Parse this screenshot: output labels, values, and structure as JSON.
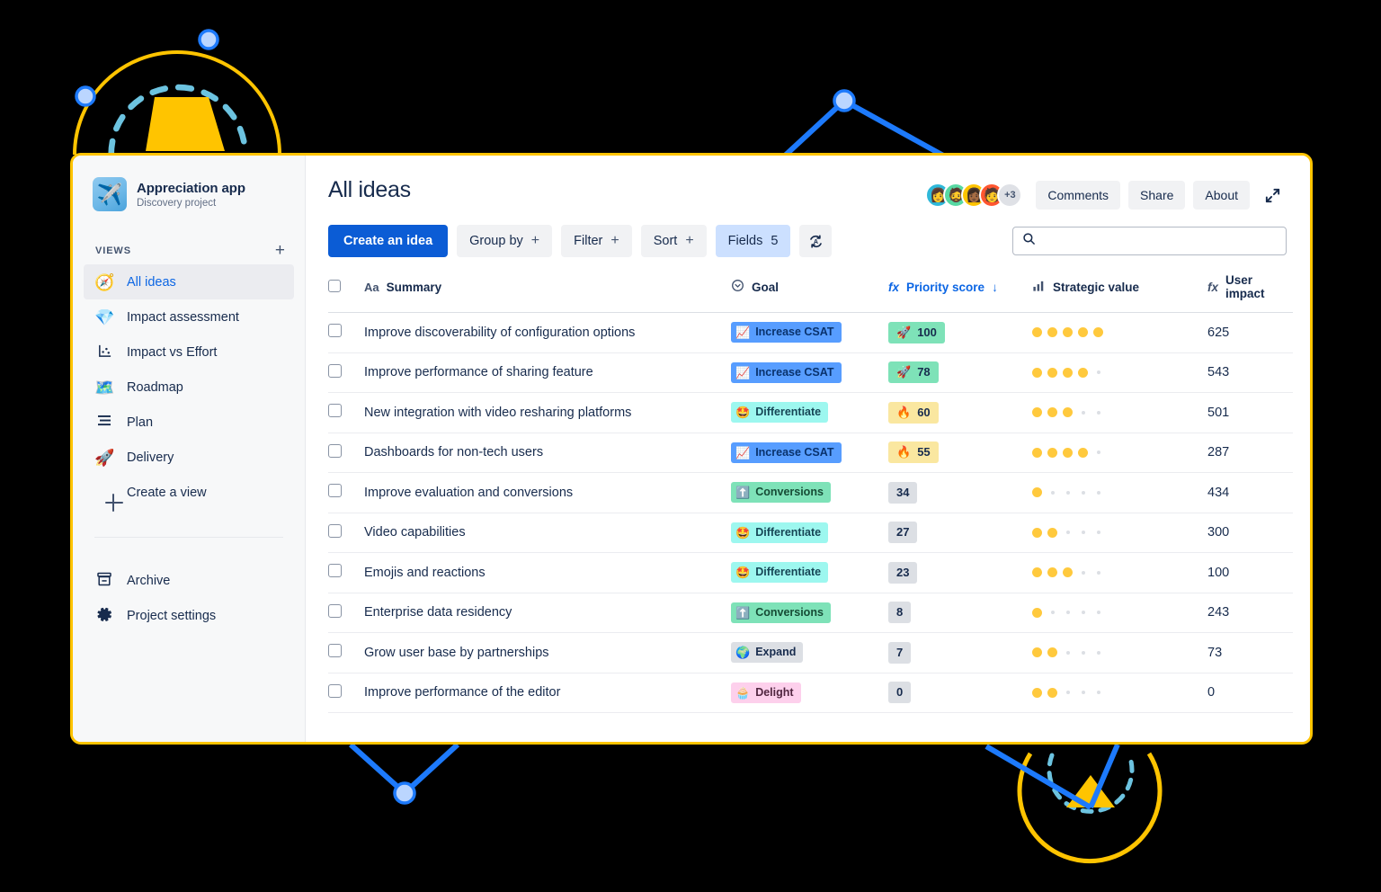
{
  "sidebar": {
    "project": {
      "name": "Appreciation app",
      "subtitle": "Discovery project",
      "logo_icon": "airplane-icon"
    },
    "views_section": {
      "title": "VIEWS",
      "add_label": "+"
    },
    "items": [
      {
        "label": "All ideas",
        "icon": "compass-icon",
        "active": true
      },
      {
        "label": "Impact assessment",
        "icon": "gem-icon",
        "active": false
      },
      {
        "label": "Impact vs Effort",
        "icon": "scatter-chart-icon",
        "active": false
      },
      {
        "label": "Roadmap",
        "icon": "map-icon",
        "active": false
      },
      {
        "label": "Plan",
        "icon": "list-lines-icon",
        "active": false
      },
      {
        "label": "Delivery",
        "icon": "rocket-icon",
        "active": false
      },
      {
        "label": "Create a view",
        "icon": "plus-icon",
        "active": false
      }
    ],
    "bottom_items": [
      {
        "label": "Archive",
        "icon": "archive-box-icon"
      },
      {
        "label": "Project settings",
        "icon": "gear-icon"
      }
    ]
  },
  "header": {
    "title": "All ideas",
    "avatars_overflow": "+3",
    "buttons": [
      {
        "label": "Comments",
        "name": "comments-button"
      },
      {
        "label": "Share",
        "name": "share-button"
      },
      {
        "label": "About",
        "name": "about-button"
      }
    ],
    "expand_icon": "expand-diagonal-icon"
  },
  "toolbar": {
    "create_label": "Create an idea",
    "group_by_label": "Group by",
    "group_by_plus": "+",
    "filter_label": "Filter",
    "filter_plus": "+",
    "sort_label": "Sort",
    "sort_plus": "+",
    "fields_label": "Fields",
    "fields_count": "5",
    "refresh_icon": "auto-refresh-icon"
  },
  "search": {
    "value": "",
    "placeholder": "",
    "icon": "search-icon"
  },
  "table": {
    "columns": [
      {
        "key": "summary",
        "label": "Summary",
        "icon": "text-aa-icon",
        "accent": false
      },
      {
        "key": "goal",
        "label": "Goal",
        "icon": "target-icon",
        "accent": false
      },
      {
        "key": "priority",
        "label": "Priority score",
        "icon": "fx-icon",
        "accent": true,
        "sort": "↓"
      },
      {
        "key": "strategic",
        "label": "Strategic value",
        "icon": "bars-icon",
        "accent": false
      },
      {
        "key": "user_impact",
        "label": "User impact",
        "icon": "fx-icon",
        "accent": false
      }
    ],
    "rows": [
      {
        "summary": "Improve discoverability of configuration options",
        "goal": "Increase CSAT",
        "goal_style": "goal-csat",
        "goal_emoji": "📈",
        "score": "100",
        "score_style": "s-green",
        "score_emoji": "🚀",
        "strategic": 5,
        "strategic_max": 5,
        "user_impact": "625"
      },
      {
        "summary": "Improve performance of sharing feature",
        "goal": "Increase CSAT",
        "goal_style": "goal-csat",
        "goal_emoji": "📈",
        "score": "78",
        "score_style": "s-green",
        "score_emoji": "🚀",
        "strategic": 4,
        "strategic_max": 5,
        "user_impact": "543"
      },
      {
        "summary": "New integration with video resharing platforms",
        "goal": "Differentiate",
        "goal_style": "goal-diff",
        "goal_emoji": "🤩",
        "score": "60",
        "score_style": "s-amber",
        "score_emoji": "🔥",
        "strategic": 3,
        "strategic_max": 5,
        "user_impact": "501"
      },
      {
        "summary": "Dashboards for non-tech users",
        "goal": "Increase CSAT",
        "goal_style": "goal-csat",
        "goal_emoji": "📈",
        "score": "55",
        "score_style": "s-amber",
        "score_emoji": "🔥",
        "strategic": 4,
        "strategic_max": 5,
        "user_impact": "287"
      },
      {
        "summary": "Improve evaluation and conversions",
        "goal": "Conversions",
        "goal_style": "goal-conv",
        "goal_emoji": "⬆️",
        "score": "34",
        "score_style": "s-grey",
        "score_emoji": "",
        "strategic": 1,
        "strategic_max": 5,
        "user_impact": "434"
      },
      {
        "summary": "Video capabilities",
        "goal": "Differentiate",
        "goal_style": "goal-diff",
        "goal_emoji": "🤩",
        "score": "27",
        "score_style": "s-grey",
        "score_emoji": "",
        "strategic": 2,
        "strategic_max": 5,
        "user_impact": "300"
      },
      {
        "summary": "Emojis and reactions",
        "goal": "Differentiate",
        "goal_style": "goal-diff",
        "goal_emoji": "🤩",
        "score": "23",
        "score_style": "s-grey",
        "score_emoji": "",
        "strategic": 3,
        "strategic_max": 5,
        "user_impact": "100"
      },
      {
        "summary": "Enterprise data residency",
        "goal": "Conversions",
        "goal_style": "goal-conv",
        "goal_emoji": "⬆️",
        "score": "8",
        "score_style": "s-grey",
        "score_emoji": "",
        "strategic": 1,
        "strategic_max": 5,
        "user_impact": "243"
      },
      {
        "summary": "Grow user base by partnerships",
        "goal": "Expand",
        "goal_style": "goal-expand",
        "goal_emoji": "🌍",
        "score": "7",
        "score_style": "s-grey",
        "score_emoji": "",
        "strategic": 2,
        "strategic_max": 5,
        "user_impact": "73"
      },
      {
        "summary": "Improve performance of the editor",
        "goal": "Delight",
        "goal_style": "goal-delight",
        "goal_emoji": "🧁",
        "score": "0",
        "score_style": "s-grey",
        "score_emoji": "",
        "strategic": 2,
        "strategic_max": 5,
        "user_impact": "0"
      }
    ]
  },
  "colors": {
    "frame_border": "#FFC400",
    "primary_button": "#0B5CD5",
    "accent_link": "#0C66E4",
    "decor_yellow": "#FFC400",
    "decor_blue": "#1D7AFC",
    "decor_cyan": "#6CC3E0",
    "background": "#000000"
  }
}
